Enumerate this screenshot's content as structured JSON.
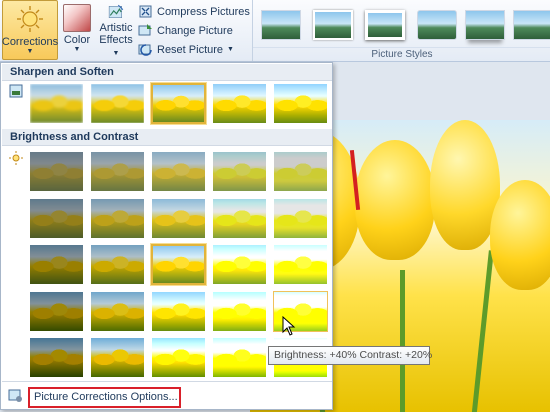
{
  "ribbon": {
    "corrections_label": "Corrections",
    "color_label": "Color",
    "artistic_line1": "Artistic",
    "artistic_line2": "Effects",
    "compress_label": "Compress Pictures",
    "change_label": "Change Picture",
    "reset_label": "Reset Picture",
    "styles_group_label": "Picture Styles"
  },
  "gallery": {
    "sharpen_heading": "Sharpen and Soften",
    "brightness_heading": "Brightness and Contrast",
    "options_label": "Picture Corrections Options...",
    "sharpen_selected_index": 2,
    "brightness_selected": {
      "row": 2,
      "col": 2
    },
    "brightness_hovered": {
      "row": 3,
      "col": 4
    }
  },
  "tooltip": {
    "text": "Brightness: +40% Contrast: +20%"
  },
  "colors": {
    "selection_border": "#e2b43a",
    "options_highlight": "#d9202a",
    "ribbon_active": "#f8c95a"
  },
  "icons": {
    "corrections": "sun-icon",
    "color": "color-icon",
    "artistic": "artistic-effects-icon",
    "compress": "compress-icon",
    "change": "change-picture-icon",
    "reset": "reset-picture-icon"
  }
}
